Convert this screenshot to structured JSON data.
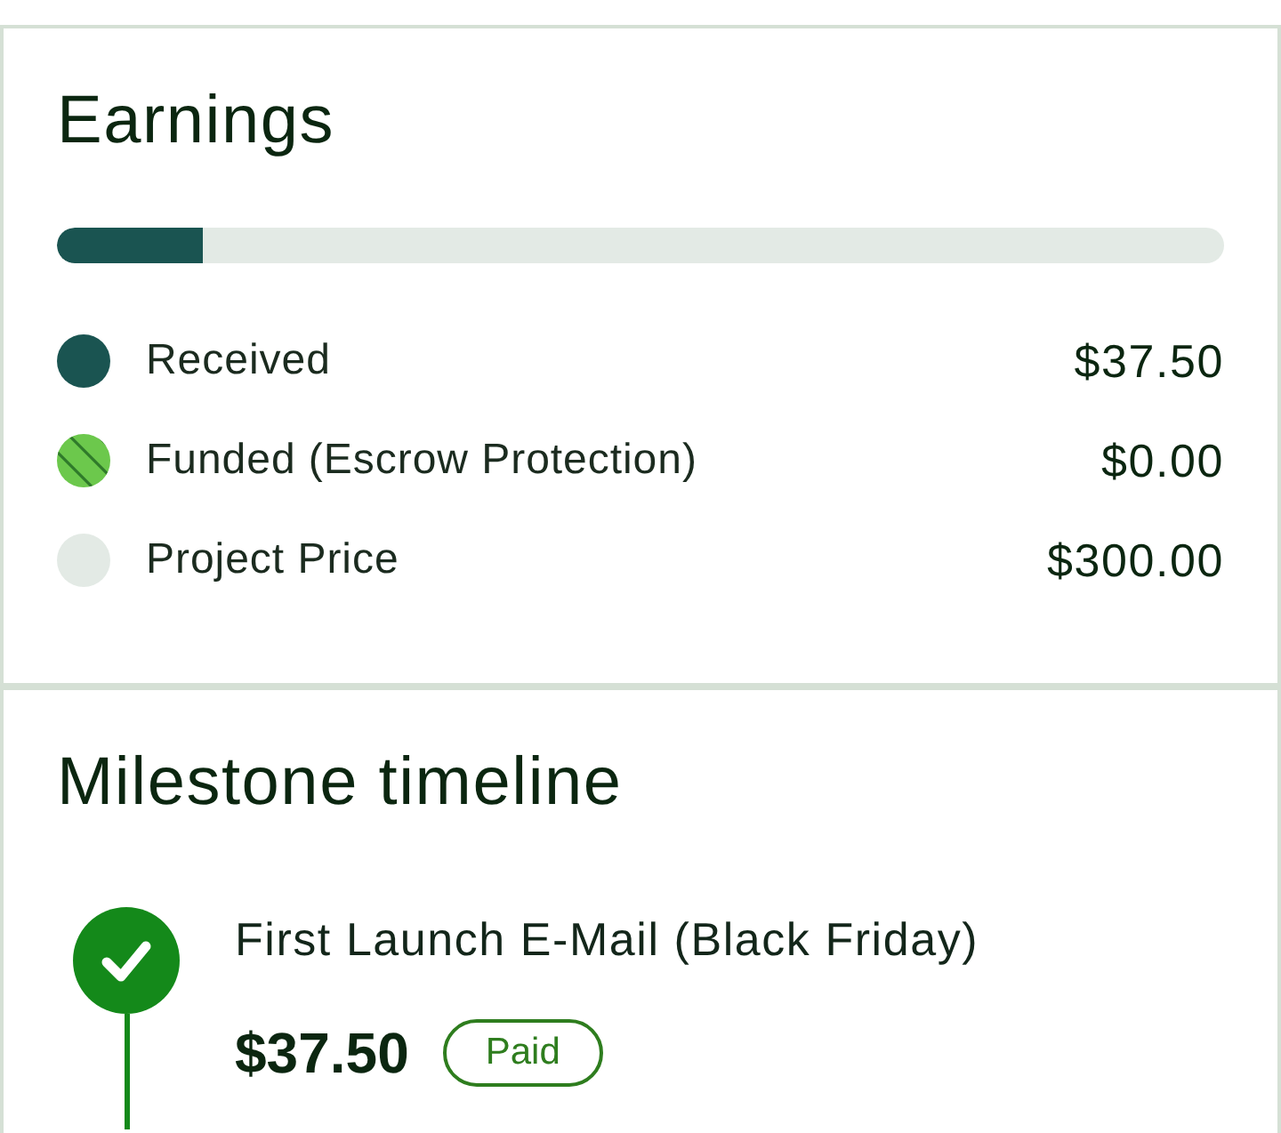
{
  "earnings": {
    "title": "Earnings",
    "progress": {
      "level": 0.125
    },
    "legend": [
      {
        "kind": "solid",
        "color": "#1a5451",
        "label": "Received",
        "amount": "$37.50"
      },
      {
        "kind": "striped",
        "color": "#6cc84c",
        "label": "Funded (Escrow Protection)",
        "amount": "$0.00"
      },
      {
        "kind": "solid",
        "color": "#e3eae5",
        "label": "Project Price",
        "amount": "$300.00"
      }
    ]
  },
  "milestones": {
    "title": "Milestone timeline",
    "items": [
      {
        "title": "First Launch E-Mail (Black Friday)",
        "amount": "$37.50",
        "status": "Paid",
        "completed": true
      }
    ]
  }
}
